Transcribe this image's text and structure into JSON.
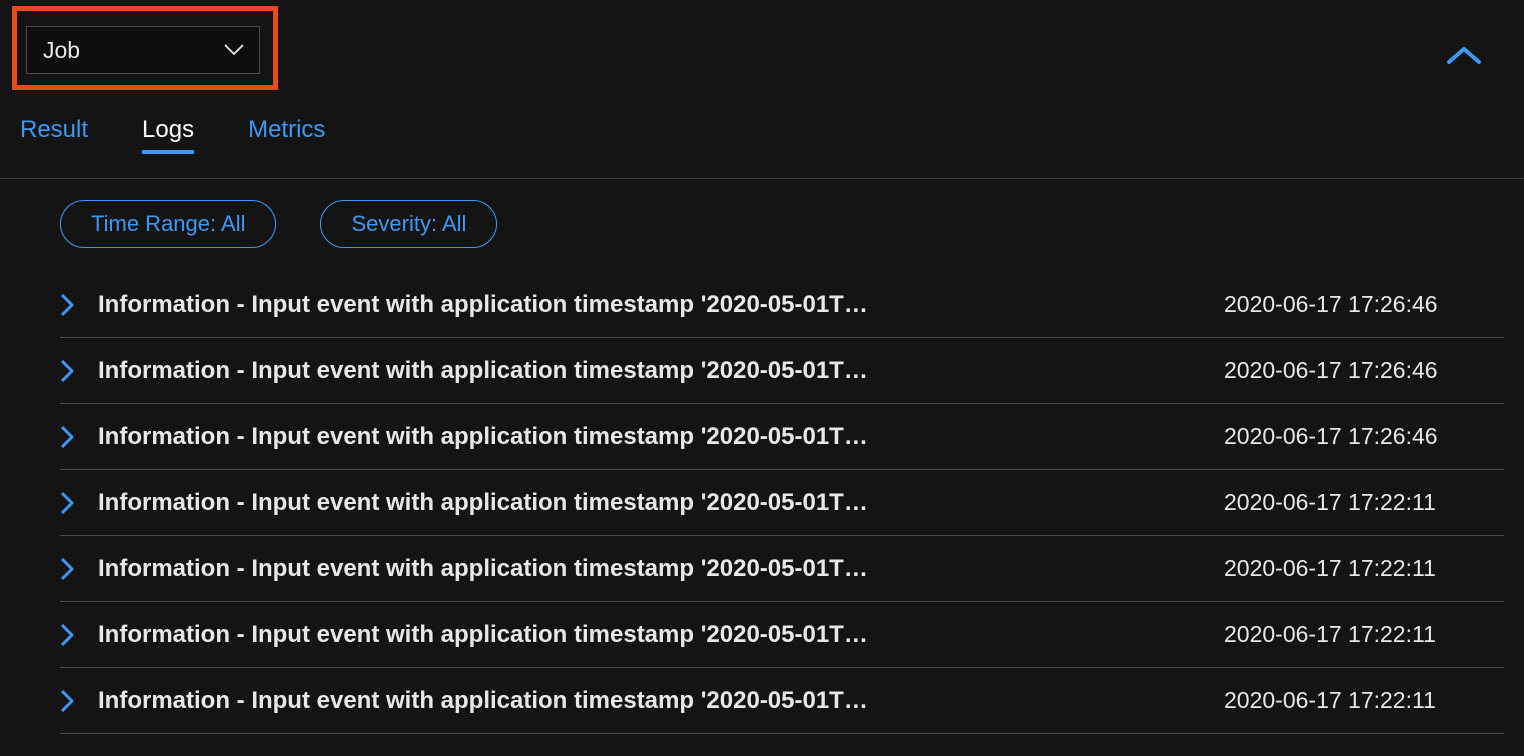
{
  "dropdown": {
    "selected": "Job"
  },
  "tabs": {
    "result": "Result",
    "logs": "Logs",
    "metrics": "Metrics",
    "active": "logs"
  },
  "filters": {
    "time_range": "Time Range: All",
    "severity": "Severity: All"
  },
  "logs": [
    {
      "message": "Information - Input event with application timestamp '2020-05-01T…",
      "timestamp": "2020-06-17 17:26:46"
    },
    {
      "message": "Information - Input event with application timestamp '2020-05-01T…",
      "timestamp": "2020-06-17 17:26:46"
    },
    {
      "message": "Information - Input event with application timestamp '2020-05-01T…",
      "timestamp": "2020-06-17 17:26:46"
    },
    {
      "message": "Information - Input event with application timestamp '2020-05-01T…",
      "timestamp": "2020-06-17 17:22:11"
    },
    {
      "message": "Information - Input event with application timestamp '2020-05-01T…",
      "timestamp": "2020-06-17 17:22:11"
    },
    {
      "message": "Information - Input event with application timestamp '2020-05-01T…",
      "timestamp": "2020-06-17 17:22:11"
    },
    {
      "message": "Information - Input event with application timestamp '2020-05-01T…",
      "timestamp": "2020-06-17 17:22:11"
    }
  ],
  "colors": {
    "accent": "#3d99f5",
    "highlight": "#e74b1b"
  }
}
